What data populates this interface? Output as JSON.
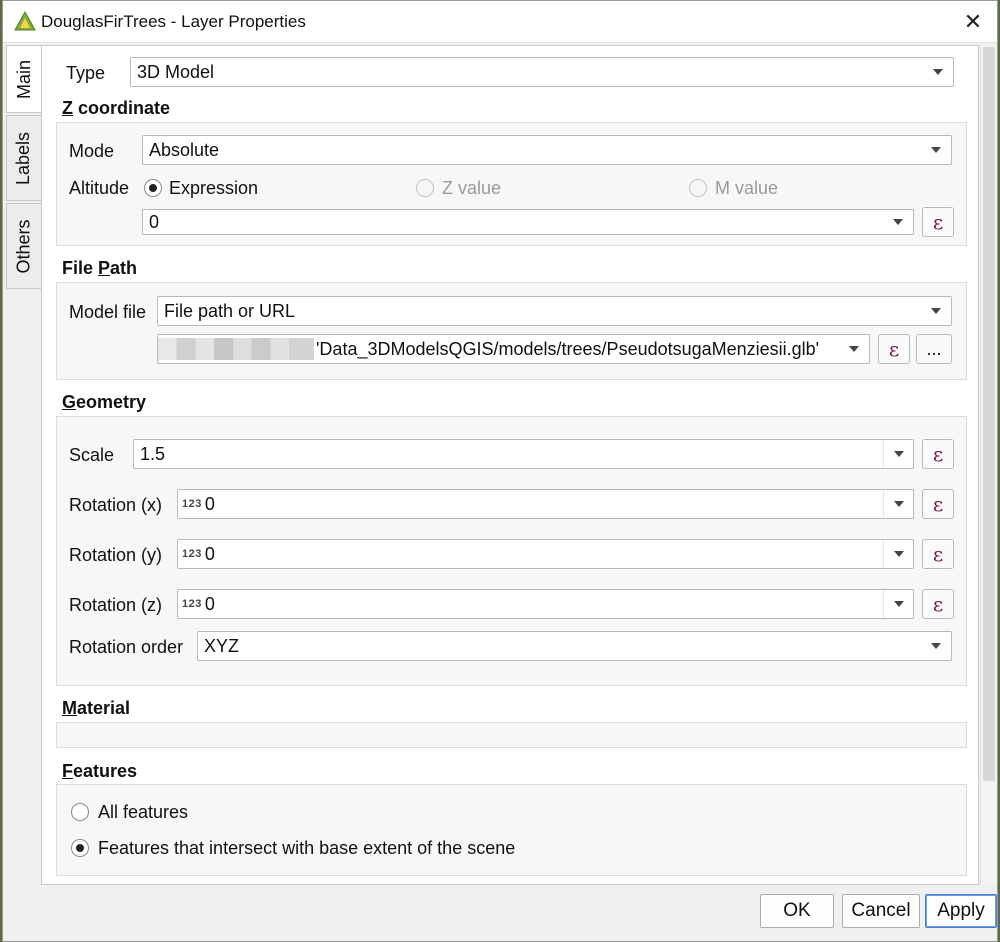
{
  "window": {
    "title": "DouglasFirTrees - Layer Properties",
    "close_glyph": "✕"
  },
  "tabs": [
    {
      "label": "Main",
      "active": true
    },
    {
      "label": "Labels",
      "active": false
    },
    {
      "label": "Others",
      "active": false
    }
  ],
  "main": {
    "type_label": "Type",
    "type_value": "3D Model",
    "z_section": {
      "title_first": "Z",
      "title_rest": " coordinate",
      "mode_label": "Mode",
      "mode_value": "Absolute",
      "altitude_label": "Altitude",
      "radio_expression": "Expression",
      "radio_z": "Z value",
      "radio_m": "M value",
      "expression_value": "0"
    },
    "file_section": {
      "title_first": "File ",
      "title_underlined": "P",
      "title_rest": "ath",
      "model_file_label": "Model file",
      "source_value": "File path or URL",
      "path_value": "'Data_3DModelsQGIS/models/trees/PseudotsugaMenziesii.glb'",
      "browse_label": "..."
    },
    "geometry_section": {
      "title_first": "G",
      "title_rest": "eometry",
      "scale_label": "Scale",
      "scale_value": "1.5",
      "rot_x_label": "Rotation (x)",
      "rot_x_value": "0",
      "rot_y_label": "Rotation (y)",
      "rot_y_value": "0",
      "rot_z_label": "Rotation (z)",
      "rot_z_value": "0",
      "num_badge": "123",
      "rotation_order_label": "Rotation order",
      "rotation_order_value": "XYZ"
    },
    "material_section": {
      "title_first": "M",
      "title_rest": "aterial"
    },
    "features_section": {
      "title_first": "F",
      "title_rest": "eatures",
      "option_all": "All features",
      "option_intersect": "Features that intersect with base extent of the scene",
      "selected": "intersect"
    },
    "expression_glyph": "ε"
  },
  "buttons": {
    "ok": "OK",
    "cancel": "Cancel",
    "apply": "Apply"
  },
  "colors": {
    "accent": "#4a7fd0",
    "qgis_green": "#6a9c2e",
    "expr_icon": "#6d1a4a"
  }
}
